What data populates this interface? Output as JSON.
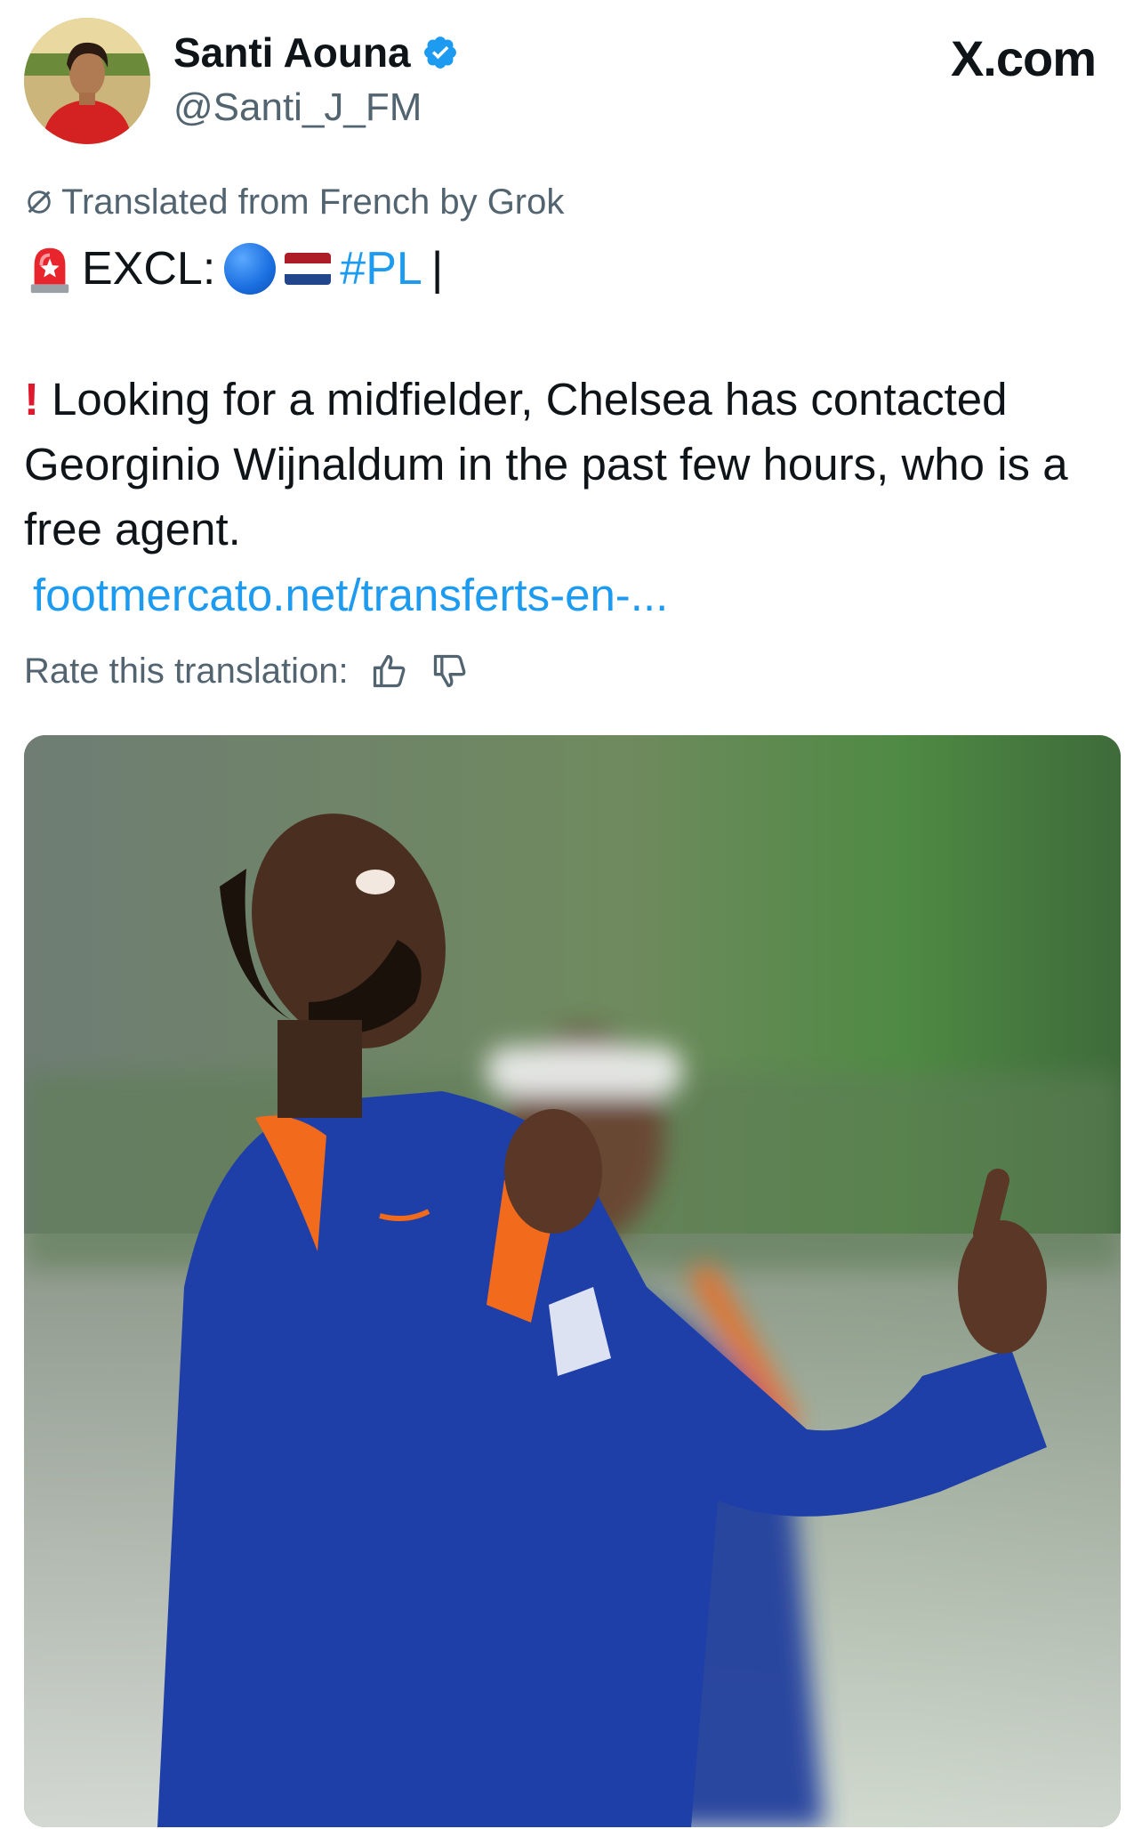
{
  "author": {
    "display_name": "Santi Aouna",
    "handle": "@Santi_J_FM",
    "verified": true,
    "avatar_icon": "avatar-photo"
  },
  "brand": "X.com",
  "translation_note": "Translated from French by Grok",
  "tweet": {
    "excl_label": "EXCL:",
    "hashtag": "#PL",
    "separator": "|",
    "body": "Looking for a midfielder, Chelsea has contacted Georginio Wijnaldum in the past few hours, who is a free agent.",
    "link": "footmercato.net/transferts-en-..."
  },
  "rate": {
    "label": "Rate this translation:"
  },
  "colors": {
    "link": "#1d9bf0",
    "muted": "#536471",
    "verified": "#1d9bf0",
    "kit_blue": "#1f3fa8",
    "kit_orange": "#f26a1b"
  }
}
